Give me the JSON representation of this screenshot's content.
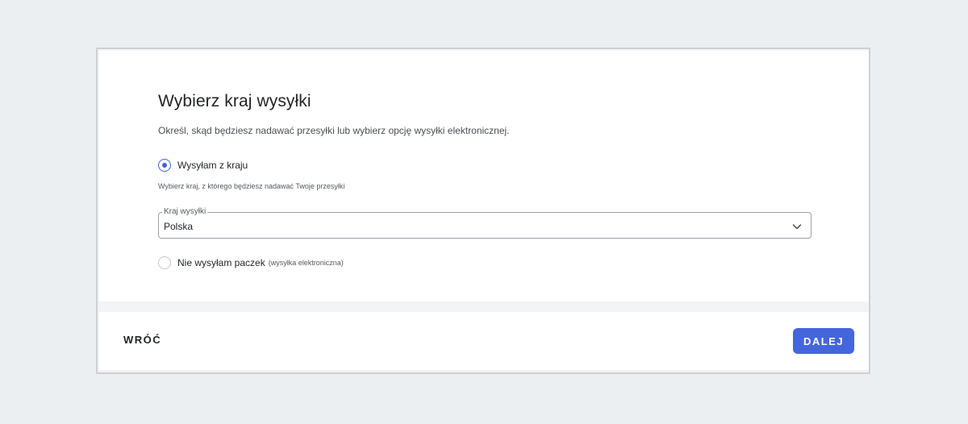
{
  "dialog": {
    "title": "Wybierz kraj wysyłki",
    "subtitle": "Określ, skąd będziesz nadawać przesyłki lub wybierz opcję wysyłki elektronicznej."
  },
  "options": {
    "domestic": {
      "label": "Wysyłam z kraju",
      "selected": true,
      "hint": "Wybierz kraj, z którego będziesz nadawać Twoje przesyłki"
    },
    "electronic": {
      "label": "Nie wysyłam paczek",
      "note": "(wysyłka elektroniczna)",
      "selected": false
    }
  },
  "country_select": {
    "label": "Kraj wysyłki",
    "value": "Polska",
    "icon": "chevron-down-icon"
  },
  "footer": {
    "back_label": "WRÓĆ",
    "next_label": "DALEJ"
  },
  "colors": {
    "accent": "#4466dc",
    "page_background": "#eceff2"
  }
}
